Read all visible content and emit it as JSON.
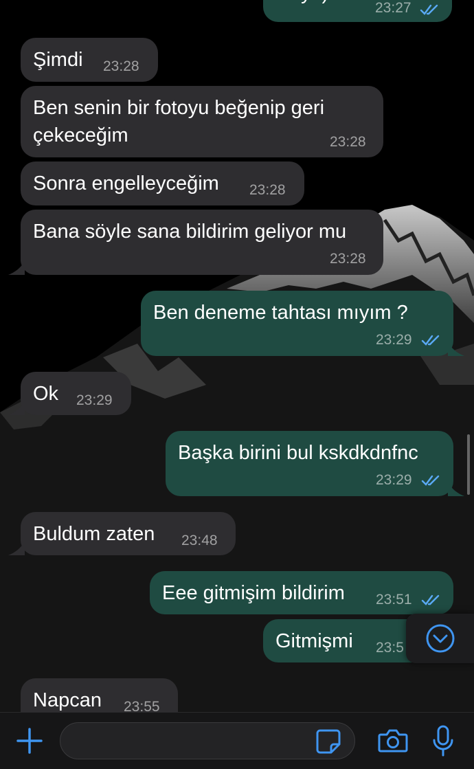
{
  "colors": {
    "incoming_bubble": "#2e2d30",
    "outgoing_bubble": "#1f4b42",
    "accent": "#3f95f1",
    "read_ticks": "#5aa9f5",
    "background": "#000000"
  },
  "messages": [
    {
      "direction": "out",
      "text": "Hey :)",
      "time": "23:27",
      "read": true,
      "partial": true
    },
    {
      "direction": "in",
      "text": "Şimdi",
      "time": "23:28"
    },
    {
      "direction": "in",
      "text": "Ben senin bir fotoyu beğenip geri çekeceğim",
      "time": "23:28"
    },
    {
      "direction": "in",
      "text": "Sonra engelleyceğim",
      "time": "23:28"
    },
    {
      "direction": "in",
      "text": "Bana söyle sana bildirim geliyor mu",
      "time": "23:28"
    },
    {
      "direction": "out",
      "text": "Ben deneme tahtası mıyım ?",
      "time": "23:29",
      "read": true
    },
    {
      "direction": "in",
      "text": "Ok",
      "time": "23:29"
    },
    {
      "direction": "out",
      "text": "Başka birini bul kskdkdnfnc",
      "time": "23:29",
      "read": true
    },
    {
      "direction": "in",
      "text": "Buldum zaten",
      "time": "23:48"
    },
    {
      "direction": "out",
      "text": "Eee gitmişim bildirim",
      "time": "23:51",
      "read": true
    },
    {
      "direction": "out",
      "text": "Gitmişmi",
      "time": "23:5"
    },
    {
      "direction": "in",
      "text": "Napcan",
      "time": "23:55"
    }
  ],
  "icons": {
    "scroll_down": "chevron-down-circle-icon",
    "attach": "plus-icon",
    "sticker": "sticker-icon",
    "camera": "camera-icon",
    "mic": "microphone-icon"
  },
  "composer": {
    "value": "",
    "placeholder": ""
  }
}
